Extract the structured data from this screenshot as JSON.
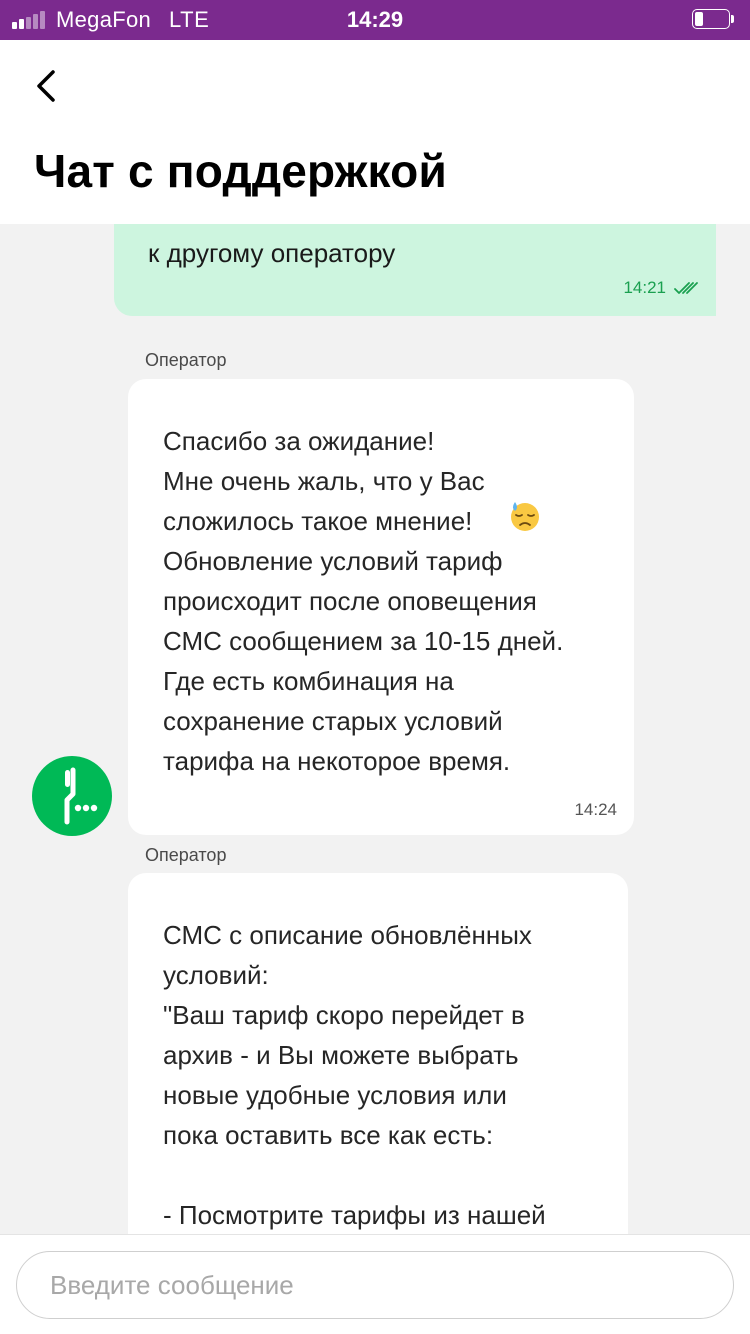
{
  "status_bar": {
    "carrier": "MegaFon",
    "network": "LTE",
    "time": "14:29",
    "signal_bars_active": 2,
    "signal_bars_total": 5,
    "battery_level": 0.25,
    "background": "#7b2a8e"
  },
  "header": {
    "back_icon": "chevron-left-icon",
    "title": "Чат с поддержкой"
  },
  "messages": [
    {
      "direction": "outgoing",
      "text": "к другому оператору",
      "time": "14:21",
      "status_icon": "double-check-icon"
    },
    {
      "direction": "incoming",
      "sender": "Оператор",
      "text": "Спасибо за ожидание!\nМне очень жаль, что у Вас\nсложилось такое мнение!\nОбновление условий тариф\nпроисходит после оповещения\nСМС сообщением за 10-15 дней.\nГде есть комбинация на\nсохранение старых условий\nтарифа на некоторое время.",
      "emoji_icon": "downcast-face-with-sweat-icon",
      "time": "14:24"
    },
    {
      "direction": "incoming",
      "sender": "Оператор",
      "text": "СМС с описание обновлённых\nусловий:\n\"Ваш тариф скоро перейдет в\nархив - и Вы можете выбрать\nновые удобные условия или\nпока оставить все как есть:\n\n- Посмотрите тарифы из нашей"
    }
  ],
  "avatar_icon": "megafon-logo-icon",
  "composer": {
    "placeholder": "Введите сообщение"
  },
  "colors": {
    "accent": "#00b956",
    "outgoing_bubble": "#cdf5df",
    "chat_background": "#f2f2f2"
  }
}
